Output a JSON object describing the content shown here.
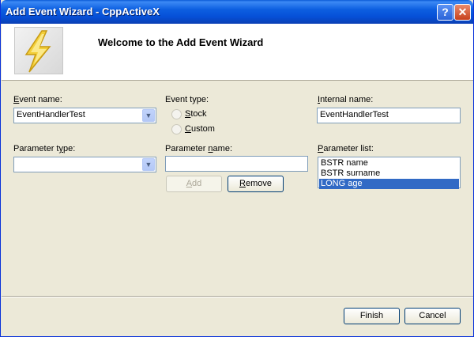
{
  "window": {
    "title": "Add Event Wizard - CppActiveX"
  },
  "titlebar_buttons": {
    "help": "?",
    "close": "✕"
  },
  "banner": {
    "heading": "Welcome to the Add Event Wizard",
    "logo_icon": "lightning-bolt-icon"
  },
  "event_name": {
    "label_pre": "",
    "label_accel": "E",
    "label_post": "vent name:",
    "value": "EventHandlerTest"
  },
  "event_type": {
    "label": "Event type:",
    "options": [
      {
        "accel": "S",
        "rest": "tock",
        "checked": false
      },
      {
        "accel": "C",
        "rest": "ustom",
        "checked": false
      }
    ]
  },
  "internal_name": {
    "label_accel": "I",
    "label_rest": "nternal name:",
    "value": "EventHandlerTest"
  },
  "parameter_type": {
    "label_pre": "Parameter t",
    "label_accel": "y",
    "label_post": "pe:",
    "value": ""
  },
  "parameter_name": {
    "label_pre": "Parameter ",
    "label_accel": "n",
    "label_post": "ame:",
    "value": ""
  },
  "parameter_list": {
    "label_accel": "P",
    "label_rest": "arameter list:",
    "items": [
      "BSTR name",
      "BSTR surname",
      "LONG age"
    ],
    "selected_index": 2
  },
  "buttons": {
    "add": {
      "accel": "A",
      "rest": "dd",
      "enabled": false
    },
    "remove": {
      "accel": "R",
      "rest": "emove",
      "enabled": true
    },
    "finish": "Finish",
    "cancel": "Cancel"
  }
}
